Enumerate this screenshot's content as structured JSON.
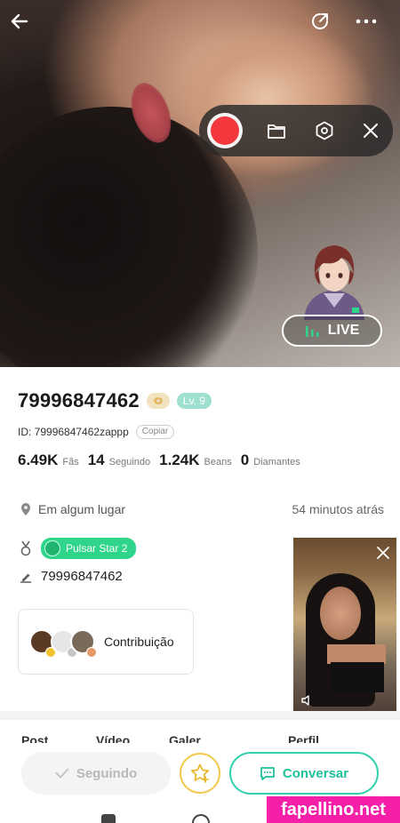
{
  "profile": {
    "uid": "79996847462",
    "level": "Lv. 9",
    "id_label": "ID: 79996847462zappp",
    "copy_label": "Copiar",
    "stats": [
      {
        "value": "6.49K",
        "label": "Fãs"
      },
      {
        "value": "14",
        "label": "Seguindo"
      },
      {
        "value": "1.24K",
        "label": "Beans"
      },
      {
        "value": "0",
        "label": "Diamantes"
      }
    ],
    "location": "Em algum lugar",
    "last_seen": "54 minutos atrás",
    "medal": "Pulsar Star 2",
    "signature": "79996847462",
    "contribution_label": "Contribuição"
  },
  "live": {
    "label": "LIVE"
  },
  "tabs_peek": [
    "Post",
    "Vídeo",
    "Galer",
    "Perfil"
  ],
  "actions": {
    "follow_label": "Seguindo",
    "chat_label": "Conversar"
  },
  "watermark": "fapellino.net",
  "colors": {
    "accent": "#33d1ad",
    "record": "#f2383c",
    "medal": "#2fd58a",
    "level": "#9de0cf",
    "watermark": "#f51fa8"
  }
}
